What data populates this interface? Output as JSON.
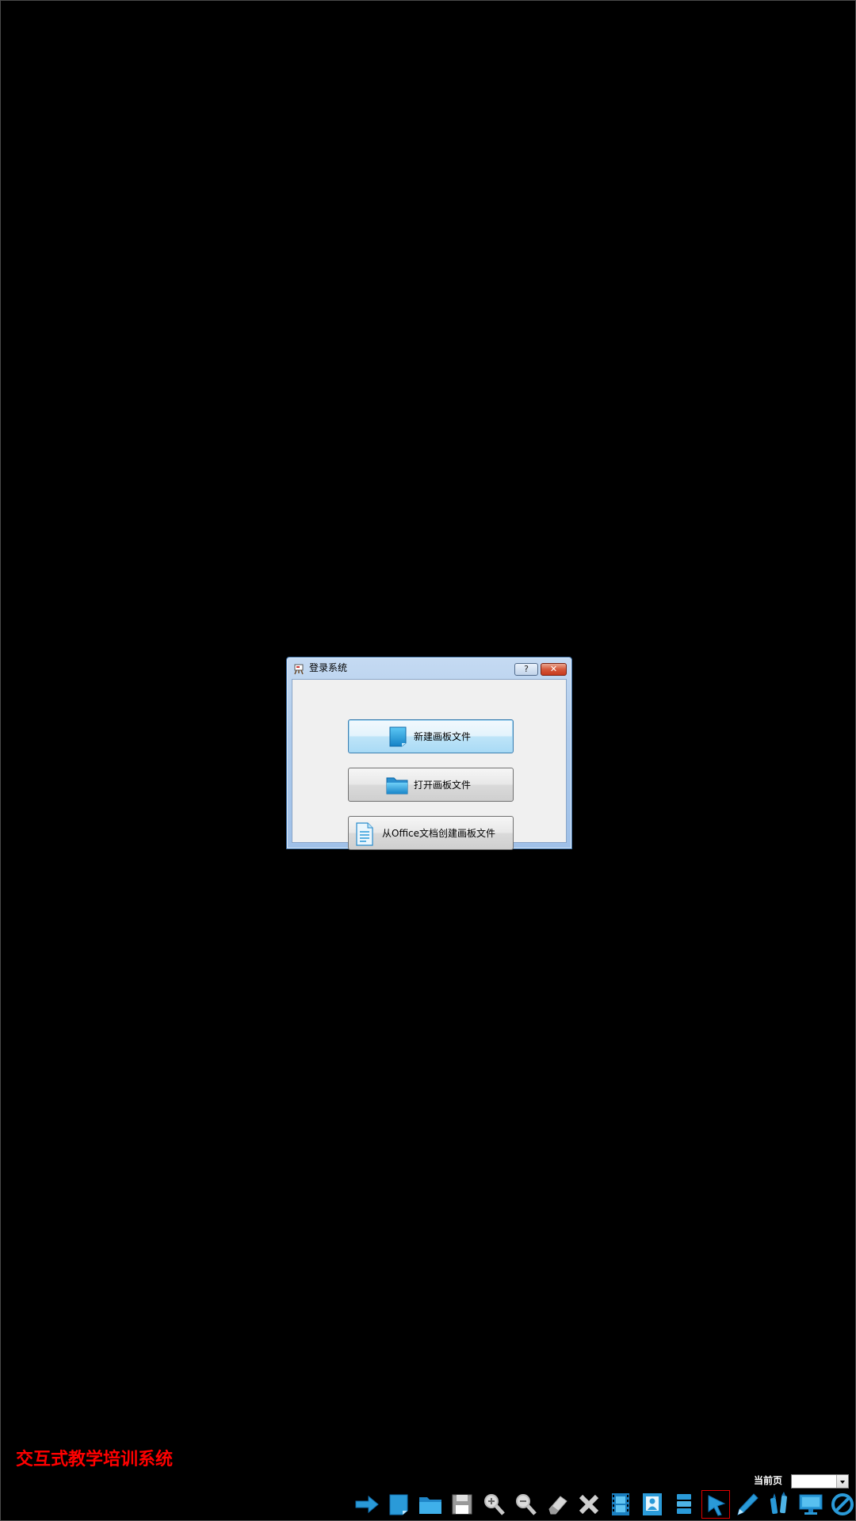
{
  "dialog": {
    "title": "登录系统",
    "help_label": "?",
    "close_label": "✕",
    "buttons": [
      {
        "label": "新建画板文件",
        "icon": "new-page-icon"
      },
      {
        "label": "打开画板文件",
        "icon": "folder-icon"
      },
      {
        "label": "从Office文档创建画板文件",
        "icon": "document-icon"
      }
    ]
  },
  "app_title": "交互式教学培训系统",
  "current_page": {
    "label": "当前页",
    "value": ""
  },
  "toolbar": {
    "tools": [
      {
        "icon": "next-arrow-icon"
      },
      {
        "icon": "new-page-icon"
      },
      {
        "icon": "open-folder-icon"
      },
      {
        "icon": "save-disk-icon"
      },
      {
        "icon": "zoom-in-icon"
      },
      {
        "icon": "zoom-out-icon"
      },
      {
        "icon": "eraser-icon"
      },
      {
        "icon": "delete-x-icon"
      },
      {
        "icon": "film-icon"
      },
      {
        "icon": "picture-icon"
      },
      {
        "icon": "layers-icon"
      },
      {
        "icon": "pointer-icon",
        "active": true
      },
      {
        "icon": "pen-icon"
      },
      {
        "icon": "markers-icon"
      },
      {
        "icon": "monitor-icon"
      },
      {
        "icon": "prohibit-icon"
      }
    ]
  },
  "colors": {
    "background": "#000000",
    "app_title": "#ff0000",
    "icon_blue": "#2a9ad8",
    "active_border": "#e00000"
  }
}
